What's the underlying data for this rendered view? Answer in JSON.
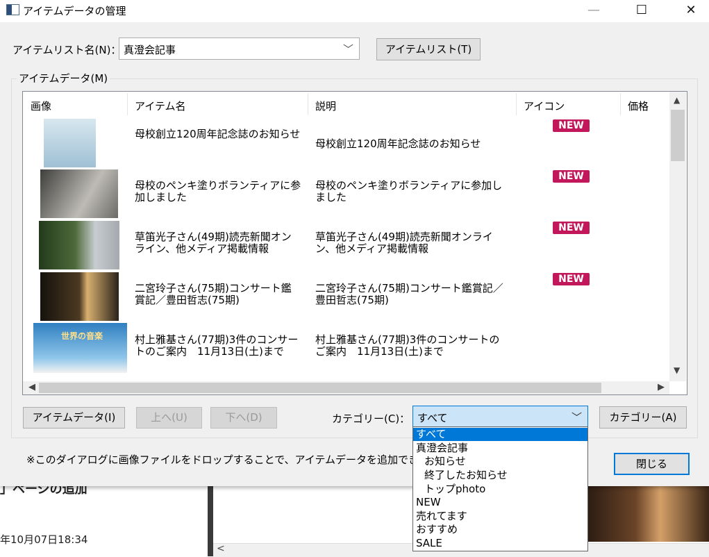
{
  "window": {
    "title": "アイテムデータの管理",
    "minimize": "—",
    "maximize": "☐",
    "close": "✕"
  },
  "item_list": {
    "label": "アイテムリスト名(N)：",
    "selected": "真澄会記事",
    "button": "アイテムリスト(T)"
  },
  "item_data_group": {
    "label": "アイテムデータ(M)",
    "columns": [
      "画像",
      "アイテム名",
      "説明",
      "アイコン",
      "価格"
    ],
    "rows": [
      {
        "name": "母校創立120周年記念誌のお知らせ",
        "description": "母校創立120周年記念誌のお知らせ",
        "icon": "NEW",
        "thumb_colors": [
          "#cfe3ec",
          "#7fa7c2"
        ]
      },
      {
        "name": "母校のペンキ塗りボランティアに参加しました",
        "description": "母校のペンキ塗りボランティアに参加しました",
        "icon": "NEW",
        "thumb_colors": [
          "#5a5a58",
          "#c9c7c0"
        ]
      },
      {
        "name": "草笛光子さん(49期)読売新聞オンライン、他メディア掲載情報",
        "description": "草笛光子さん(49期)読売新聞オンライン、他メディア掲載情報",
        "icon": "NEW",
        "thumb_colors": [
          "#2f4a25",
          "#c6c9cc"
        ]
      },
      {
        "name": "二宮玲子さん(75期)コンサート鑑賞記／豊田哲志(75期)",
        "description": "二宮玲子さん(75期)コンサート鑑賞記／豊田哲志(75期)",
        "icon": "NEW",
        "thumb_colors": [
          "#1d1a14",
          "#8a6a3a"
        ]
      },
      {
        "name": "村上雅基さん(77期)3件のコンサートのご案内　11月13日(土)まで",
        "description": "村上雅基さん(77期)3件のコンサートのご案内　11月13日(土)まで",
        "icon": "",
        "thumb_colors": [
          "#3f8fd0",
          "#a9d4f0"
        ],
        "thumb_caption": "世界の音楽"
      }
    ]
  },
  "buttons": {
    "item_data": "アイテムデータ(I)",
    "up": "上へ(U)",
    "down": "下へ(D)",
    "category": "カテゴリー(A)",
    "close": "閉じる"
  },
  "category": {
    "label": "カテゴリー(C)：",
    "selected": "すべて",
    "options": [
      "すべて",
      "真澄会記事",
      "お知らせ",
      "終了したお知らせ",
      "トップphoto",
      "NEW",
      "売れてます",
      "おすすめ",
      "SALE"
    ],
    "indent": [
      0,
      0,
      1,
      1,
      1,
      0,
      0,
      0,
      0
    ]
  },
  "note": "※このダイアログに画像ファイルをドロップすることで、アイテムデータを追加できます",
  "background_page": {
    "heading": "」ページの追加",
    "date": "年10月07日18:34"
  },
  "colors": {
    "badge": "#c2185b",
    "accent": "#0078d7"
  }
}
